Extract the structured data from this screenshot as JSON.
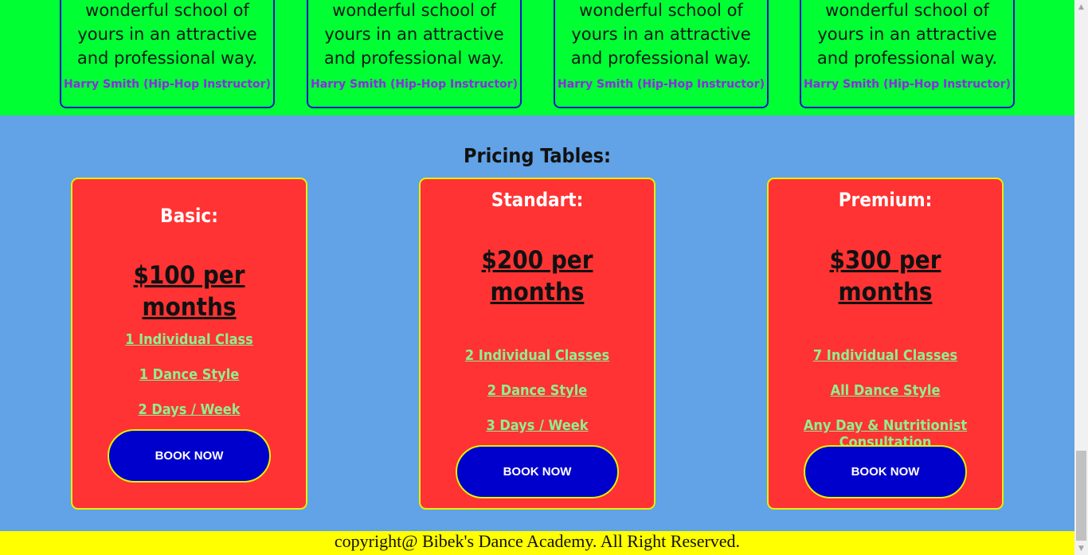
{
  "testimonials": [
    {
      "quote": "wonderful school of yours in an attractive and professional way.",
      "author": "Harry Smith (Hip-Hop Instructor)"
    },
    {
      "quote": "wonderful school of yours in an attractive and professional way.",
      "author": "Harry Smith (Hip-Hop Instructor)"
    },
    {
      "quote": "wonderful school of yours in an attractive and professional way.",
      "author": "Harry Smith (Hip-Hop Instructor)"
    },
    {
      "quote": "wonderful school of yours in an attractive and professional way.",
      "author": "Harry Smith (Hip-Hop Instructor)"
    }
  ],
  "pricing": {
    "title": "Pricing Tables:",
    "plans": [
      {
        "name": "Basic:",
        "price": "$100 per months",
        "features": [
          "1 Individual Class",
          "1 Dance Style",
          "2 Days / Week"
        ],
        "button": "BOOK NOW"
      },
      {
        "name": "Standart:",
        "price": "$200 per months",
        "features": [
          "2 Individual Classes",
          "2 Dance Style",
          "3 Days / Week"
        ],
        "button": "BOOK NOW"
      },
      {
        "name": "Premium:",
        "price": "$300 per months",
        "features": [
          "7 Individual Classes",
          "All Dance Style",
          "Any Day & Nutritionist Consultation"
        ],
        "button": "BOOK NOW"
      }
    ]
  },
  "footer": {
    "text": "copyright@ Bibek's Dance Academy. All Right Reserved."
  },
  "colors": {
    "testimonial_bg": "#00ff33",
    "pricing_bg": "#62a2e6",
    "card_bg": "#ff3333",
    "card_border": "#e2f200",
    "button_bg": "#0000cc",
    "feature_link": "#90ee90",
    "author_text": "#8a2be2",
    "footer_bg": "#ffff00"
  }
}
